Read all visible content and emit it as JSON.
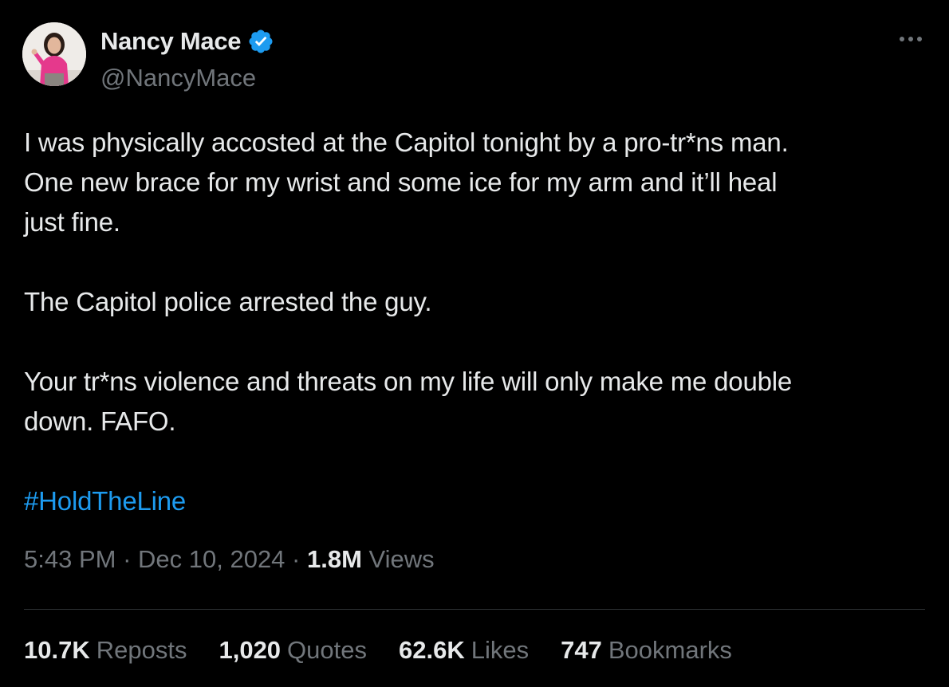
{
  "author": {
    "display_name": "Nancy Mace",
    "handle": "@NancyMace",
    "verified_icon": "verified-badge-icon",
    "avatar_icon": "profile-photo"
  },
  "tweet": {
    "paragraphs": [
      "I was physically accosted at the Capitol tonight by a pro-tr*ns man.\nOne new brace for my wrist and some ice for my arm and it’ll heal\njust fine.",
      "The Capitol police arrested the guy.",
      "Your tr*ns violence and threats on my life will only make me double\ndown. FAFO."
    ],
    "hashtag": "#HoldTheLine"
  },
  "meta": {
    "time": "5:43 PM",
    "separator": " · ",
    "date": "Dec 10, 2024",
    "views_count": "1.8M",
    "views_label": "Views"
  },
  "stats": {
    "reposts": {
      "count": "10.7K",
      "label": "Reposts"
    },
    "quotes": {
      "count": "1,020",
      "label": "Quotes"
    },
    "likes": {
      "count": "62.6K",
      "label": "Likes"
    },
    "bookmarks": {
      "count": "747",
      "label": "Bookmarks"
    }
  },
  "colors": {
    "background": "#000000",
    "text": "#e7e9ea",
    "muted": "#71767b",
    "accent": "#1d9bf0",
    "divider": "#2f3336"
  }
}
